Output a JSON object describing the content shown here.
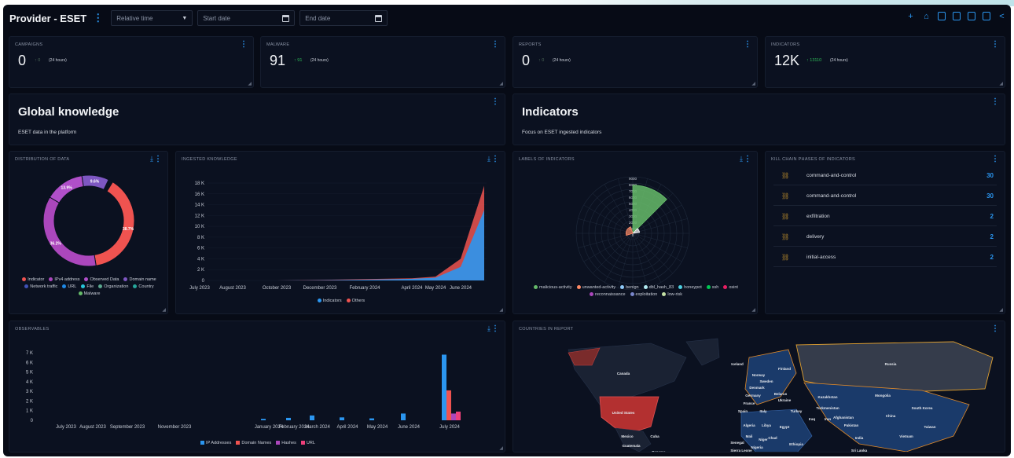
{
  "header": {
    "title": "Provider - ESET",
    "relative_time": "Relative time",
    "start_date": "Start date",
    "end_date": "End date",
    "toolbar_icons": [
      "plus-icon",
      "share-icon",
      "copy-icon",
      "save-icon",
      "export-icon",
      "pdf-icon",
      "share-link-icon"
    ]
  },
  "kpis": [
    {
      "label": "CAMPAIGNS",
      "value": "0",
      "delta": "0",
      "period": "(24 hours)"
    },
    {
      "label": "MALWARE",
      "value": "91",
      "delta": "91",
      "period": "(24 hours)"
    },
    {
      "label": "REPORTS",
      "value": "0",
      "delta": "0",
      "period": "(24 hours)"
    },
    {
      "label": "INDICATORS",
      "value": "12K",
      "delta": "13110",
      "period": "(24 hours)"
    }
  ],
  "banners": [
    {
      "title": "Global knowledge",
      "subtitle": "ESET data in the platform"
    },
    {
      "title": "Indicators",
      "subtitle": "Focus on ESET ingested indicators"
    }
  ],
  "distribution": {
    "title": "DISTRIBUTION OF DATA",
    "slices": [
      {
        "name": "Indicator",
        "value": 38.7,
        "label": "38.7%",
        "color": "#ef5350"
      },
      {
        "name": "IPv4 address",
        "value": 36.2,
        "label": "36.2%",
        "color": "#ab47bc"
      },
      {
        "name": "Observed Data",
        "value": 13.9,
        "label": "13.9%",
        "color": "#b04fc9"
      },
      {
        "name": "Domain name",
        "value": 9.6,
        "label": "9.6%",
        "color": "#7e57c2"
      },
      {
        "name": "Network traffic",
        "value": 0.3,
        "label": "",
        "color": "#3f51b5"
      },
      {
        "name": "URL",
        "value": 0.3,
        "label": "",
        "color": "#1e88e5"
      },
      {
        "name": "File",
        "value": 0.3,
        "label": "",
        "color": "#26c6da"
      },
      {
        "name": "Organization",
        "value": 0.3,
        "label": "",
        "color": "#5ba88f"
      },
      {
        "name": "Country",
        "value": 0.2,
        "label": "",
        "color": "#26a69a"
      },
      {
        "name": "Malware",
        "value": 0.2,
        "label": "",
        "color": "#66bb6a"
      }
    ],
    "legend": [
      "Indicator",
      "IPv4 address",
      "Observed Data",
      "Domain name",
      "Network traffic",
      "URL",
      "File",
      "Organization",
      "Country",
      "Malware"
    ]
  },
  "ingested": {
    "title": "INGESTED KNOWLEDGE",
    "y_ticks": [
      "18 K",
      "16 K",
      "14 K",
      "12 K",
      "10 K",
      "8 K",
      "6 K",
      "4 K",
      "2 K",
      "0"
    ],
    "x_ticks": [
      "July 2023",
      "August 2023",
      "October 2023",
      "December 2023",
      "February 2024",
      "April 2024",
      "May 2024",
      "June 2024"
    ],
    "legend": [
      {
        "name": "Indicators",
        "color": "#2b96f0"
      },
      {
        "name": "Others",
        "color": "#ef5350"
      }
    ]
  },
  "labels_radar": {
    "title": "LABELS OF INDICATORS",
    "r_ticks": [
      "9000",
      "8000",
      "7000",
      "6000",
      "5000",
      "4000",
      "3000",
      "2000",
      "1000",
      "0"
    ],
    "legend": [
      {
        "name": "malicious-activity",
        "color": "#66bb6a"
      },
      {
        "name": "unwanted-activity",
        "color": "#ff8a65"
      },
      {
        "name": "benign",
        "color": "#90caf9"
      },
      {
        "name": "dbl_hash_83",
        "color": "#b2ebf2"
      },
      {
        "name": "honeypot",
        "color": "#4dd0e1"
      },
      {
        "name": "ssh",
        "color": "#00c853"
      },
      {
        "name": "osint",
        "color": "#e91e63"
      },
      {
        "name": "reconnaissance",
        "color": "#ab47bc"
      },
      {
        "name": "exploitation",
        "color": "#7986cb"
      },
      {
        "name": "low-risk",
        "color": "#c5e1a5"
      }
    ]
  },
  "kill_chain": {
    "title": "KILL CHAIN PHASES OF INDICATORS",
    "rows": [
      {
        "label": "command-and-control",
        "count": "30"
      },
      {
        "label": "command-and-control",
        "count": "30"
      },
      {
        "label": "exfiltration",
        "count": "2"
      },
      {
        "label": "delivery",
        "count": "2"
      },
      {
        "label": "initial-access",
        "count": "2"
      }
    ]
  },
  "observables": {
    "title": "OBSERVABLES",
    "y_ticks": [
      "7 K",
      "6 K",
      "5 K",
      "4 K",
      "3 K",
      "2 K",
      "1 K",
      "0"
    ],
    "x_ticks": [
      "July 2023",
      "August 2023",
      "September 2023",
      "November 2023",
      "January 2024",
      "February 2024",
      "March 2024",
      "April 2024",
      "May 2024",
      "June 2024",
      "July 2024"
    ],
    "legend": [
      {
        "name": "IP Addresses",
        "color": "#2b96f0"
      },
      {
        "name": "Domain Names",
        "color": "#ef5350"
      },
      {
        "name": "Hashes",
        "color": "#ab47bc"
      },
      {
        "name": "URL",
        "color": "#ec407a"
      }
    ]
  },
  "countries": {
    "title": "COUNTRIES IN REPORT",
    "labels": [
      "Canada",
      "United States",
      "Mexico",
      "Cuba",
      "Guatemala",
      "Panama",
      "Iceland",
      "Finland",
      "Norway",
      "Sweden",
      "Denmark",
      "Belarus",
      "Ukraine",
      "France",
      "Spain",
      "Italy",
      "Turkey",
      "Kazakhstan",
      "Turkmenistan",
      "Russia",
      "Mongolia",
      "China",
      "South Korea",
      "Taiwan",
      "Vietnam",
      "Afghanistan",
      "Pakistan",
      "Iran",
      "Iraq",
      "Algeria",
      "Libya",
      "Egypt",
      "Chad",
      "Mali",
      "Niger",
      "Senegal",
      "Nigeria",
      "Ethiopia",
      "Sierra Leone",
      "Sri Lanka",
      "India",
      "Germany"
    ]
  },
  "chart_data": [
    {
      "type": "pie",
      "title": "DISTRIBUTION OF DATA",
      "categories": [
        "Indicator",
        "IPv4 address",
        "Observed Data",
        "Domain name",
        "Network traffic",
        "URL",
        "File",
        "Organization",
        "Country",
        "Malware"
      ],
      "values": [
        38.7,
        36.2,
        13.9,
        9.6,
        0.3,
        0.3,
        0.3,
        0.3,
        0.2,
        0.2
      ]
    },
    {
      "type": "area",
      "title": "INGESTED KNOWLEDGE",
      "x": [
        "July 2023",
        "August 2023",
        "October 2023",
        "December 2023",
        "February 2024",
        "April 2024",
        "May 2024",
        "June 2024",
        "June 2024 end"
      ],
      "series": [
        {
          "name": "Indicators",
          "values": [
            0,
            0,
            0,
            50,
            150,
            300,
            500,
            2500,
            13000
          ]
        },
        {
          "name": "Others",
          "values": [
            0,
            0,
            0,
            100,
            250,
            400,
            700,
            4000,
            17500
          ]
        }
      ],
      "ylim": [
        0,
        18000
      ]
    },
    {
      "type": "bar",
      "title": "OBSERVABLES",
      "categories": [
        "July 2023",
        "August 2023",
        "September 2023",
        "November 2023",
        "January 2024",
        "February 2024",
        "March 2024",
        "April 2024",
        "May 2024",
        "June 2024",
        "July 2024"
      ],
      "series": [
        {
          "name": "IP Addresses",
          "values": [
            0,
            0,
            0,
            0,
            150,
            250,
            500,
            300,
            200,
            700,
            6800
          ]
        },
        {
          "name": "Domain Names",
          "values": [
            0,
            0,
            0,
            0,
            0,
            0,
            0,
            0,
            0,
            0,
            3100
          ]
        },
        {
          "name": "Hashes",
          "values": [
            0,
            0,
            0,
            0,
            0,
            0,
            0,
            0,
            0,
            0,
            700
          ]
        },
        {
          "name": "URL",
          "values": [
            0,
            0,
            0,
            0,
            0,
            0,
            0,
            0,
            0,
            0,
            900
          ]
        }
      ],
      "ylim": [
        0,
        7000
      ]
    }
  ]
}
